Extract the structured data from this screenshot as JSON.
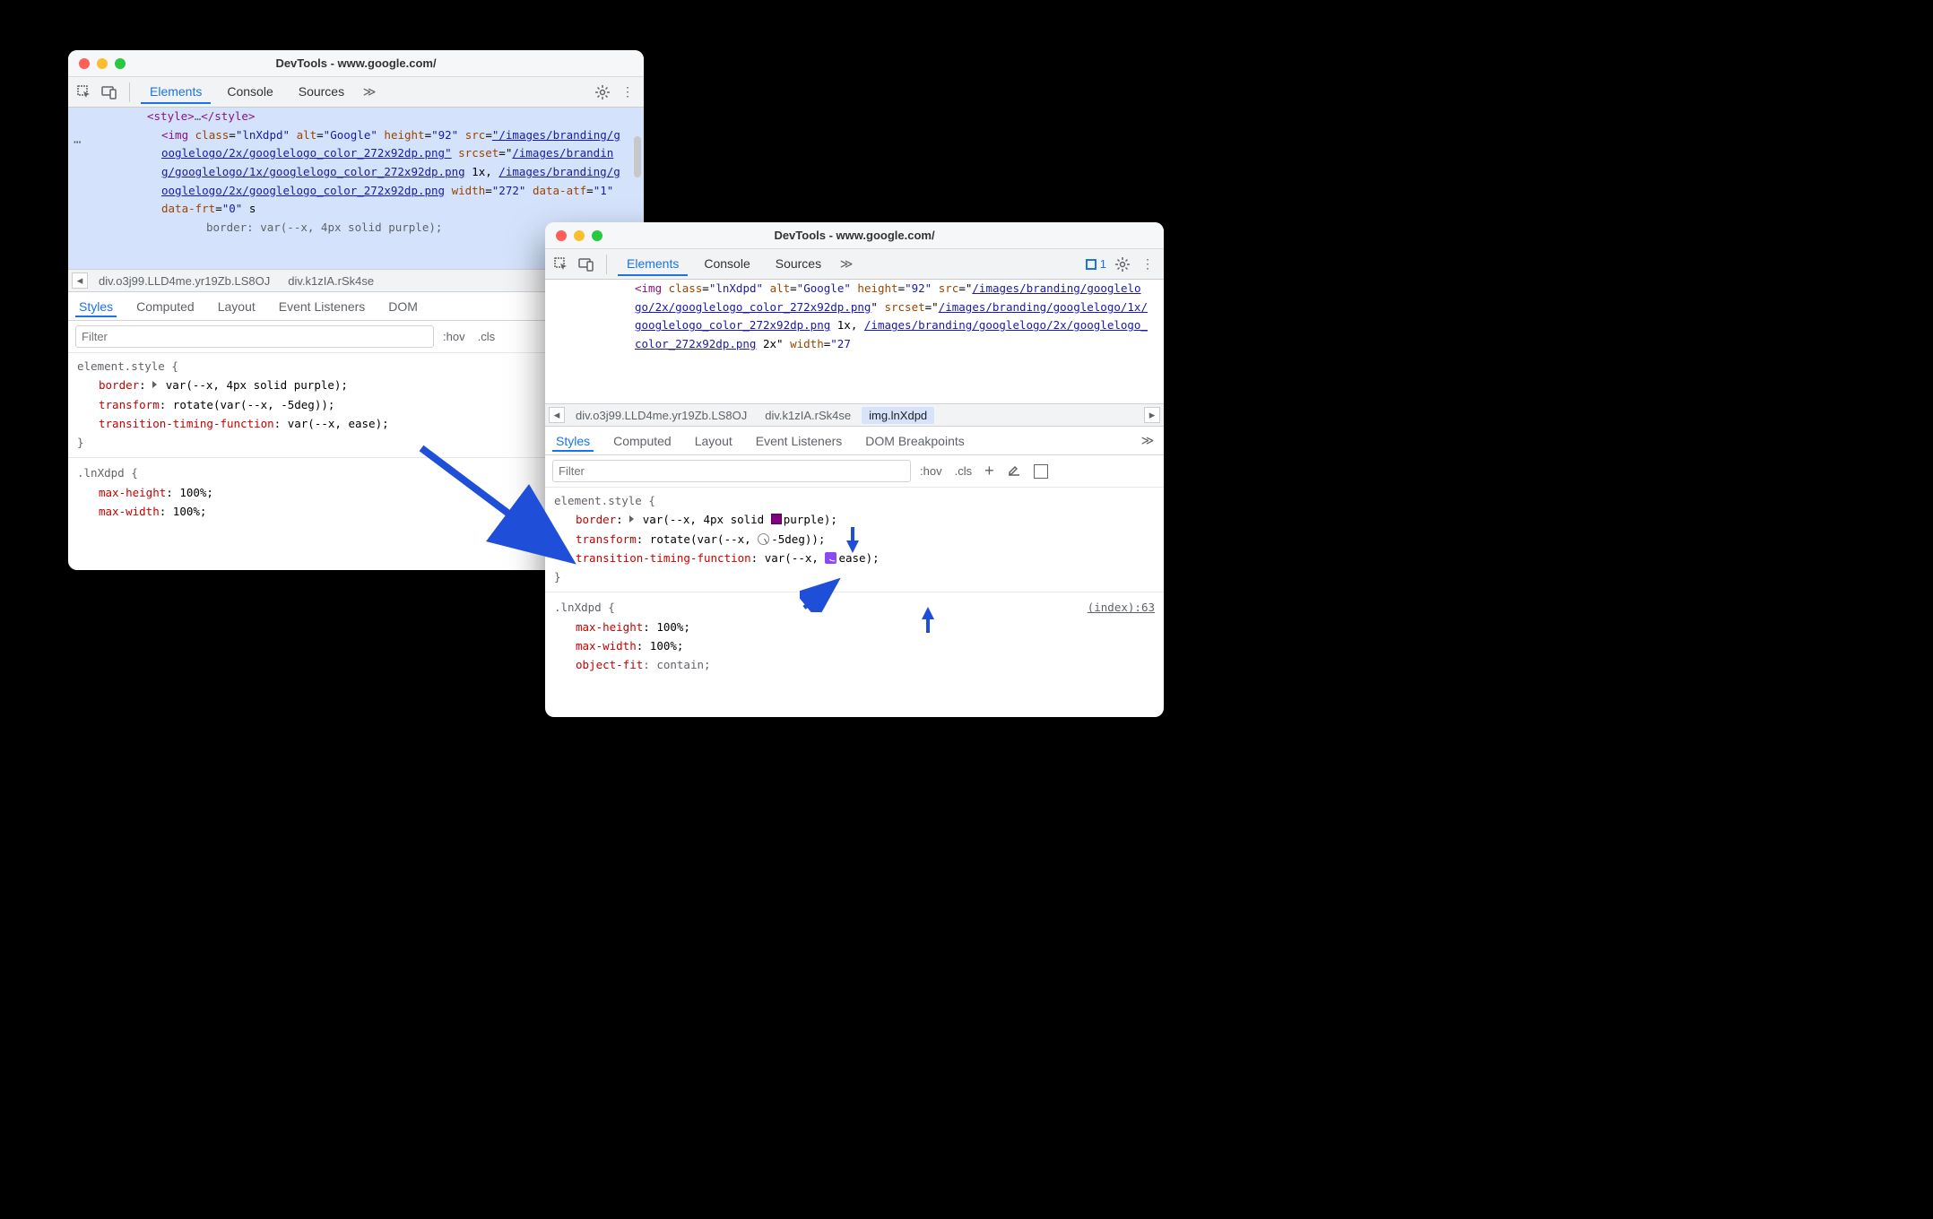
{
  "windows": {
    "left": {
      "title": "DevTools - www.google.com/",
      "tabs": {
        "elements": "Elements",
        "console": "Console",
        "sources": "Sources"
      },
      "dom": {
        "style_open": "<style>",
        "style_ellipsis": "…",
        "style_close": "</style>",
        "img_tag": "<img",
        "class_attr": "class",
        "class_val": "\"lnXdpd\"",
        "alt_attr": "alt",
        "alt_val": "\"Google\"",
        "height_attr": "height",
        "height_val": "\"92\"",
        "src_attr": "src",
        "src_val": "\"/images/branding/googlelogo/2x/googlelogo_color_272x92dp.png\"",
        "srcset_attr": "srcset",
        "srcset_val_link1": "/images/branding/googlelogo/1x/googlelogo_color_272x92dp.png",
        "srcset_val_1x": " 1x, ",
        "srcset_val_link2": "/images/branding/googlelogo/2x/googlelogo_color_272x92dp.png",
        "width_attr": "width",
        "width_val": "\"272\"",
        "data_atf_attr": "data-atf",
        "data_atf_val": "\"1\"",
        "data_frt_attr": "data-frt",
        "data_frt_val": "\"0\"",
        "inline_style": "border: var(--x, 4px solid purple);"
      },
      "crumbs": {
        "c1": "div.o3j99.LLD4me.yr19Zb.LS8OJ",
        "c2": "div.k1zIA.rSk4se"
      },
      "subtabs": {
        "styles": "Styles",
        "computed": "Computed",
        "layout": "Layout",
        "listeners": "Event Listeners",
        "dom": "DOM "
      },
      "filter": {
        "placeholder": "Filter",
        "hov": ":hov",
        "cls": ".cls"
      },
      "styles": {
        "selector": "element.style {",
        "p1n": "border",
        "p1v": "var(--x, 4px solid purple);",
        "p2n": "transform",
        "p2v": "rotate(var(--x, -5deg));",
        "p3n": "transition-timing-function",
        "p3v": "var(--x, ease);",
        "close": "}",
        "rule2_sel": ".lnXdpd {",
        "r2p1n": "max-height",
        "r2p1v": "100%;",
        "r2p2n": "max-width",
        "r2p2v": "100%;"
      }
    },
    "right": {
      "title": "DevTools - www.google.com/",
      "tabs": {
        "elements": "Elements",
        "console": "Console",
        "sources": "Sources"
      },
      "issues_count": "1",
      "dom": {
        "img_tag": "<img",
        "class_attr": "class",
        "class_val": "\"lnXdpd\"",
        "alt_attr": "alt",
        "alt_val": "\"Google\"",
        "height_attr": "height",
        "height_val": "\"92\"",
        "src_attr": "src",
        "src_link": "/images/branding/googlelogo/2x/googlelogo_color_272x92dp.png",
        "srcset_attr": "srcset",
        "srcset_link1": "/images/branding/googlelogo/1x/googlelogo_color_272x92dp.png",
        "srcset_1x": " 1x, ",
        "srcset_link2": "/images/branding/googlelogo/2x/googlelogo_color_272x92dp.png",
        "srcset_2x": " 2x\"",
        "width_attr": "width",
        "width_val": "\"27"
      },
      "crumbs": {
        "c1": "div.o3j99.LLD4me.yr19Zb.LS8OJ",
        "c2": "div.k1zIA.rSk4se",
        "c3": "img.lnXdpd"
      },
      "subtabs": {
        "styles": "Styles",
        "computed": "Computed",
        "layout": "Layout",
        "listeners": "Event Listeners",
        "dom": "DOM Breakpoints"
      },
      "filter": {
        "placeholder": "Filter",
        "hov": ":hov",
        "cls": ".cls"
      },
      "styles": {
        "selector": "element.style {",
        "p1n": "border",
        "p1v_pre": "var(--x, 4px solid ",
        "p1v_post": "purple);",
        "p2n": "transform",
        "p2v_pre": "rotate(var(--x, ",
        "p2v_post": "-5deg));",
        "p3n": "transition-timing-function",
        "p3v_pre": "var(--x, ",
        "p3v_post": "ease);",
        "close": "}",
        "src_link": "(index):63",
        "rule2_sel": ".lnXdpd {",
        "r2p1n": "max-height",
        "r2p1v": "100%;",
        "r2p2n": "max-width",
        "r2p2v": "100%;",
        "r2p3n": "object-fit",
        "r2p3v": "contain;"
      }
    }
  }
}
